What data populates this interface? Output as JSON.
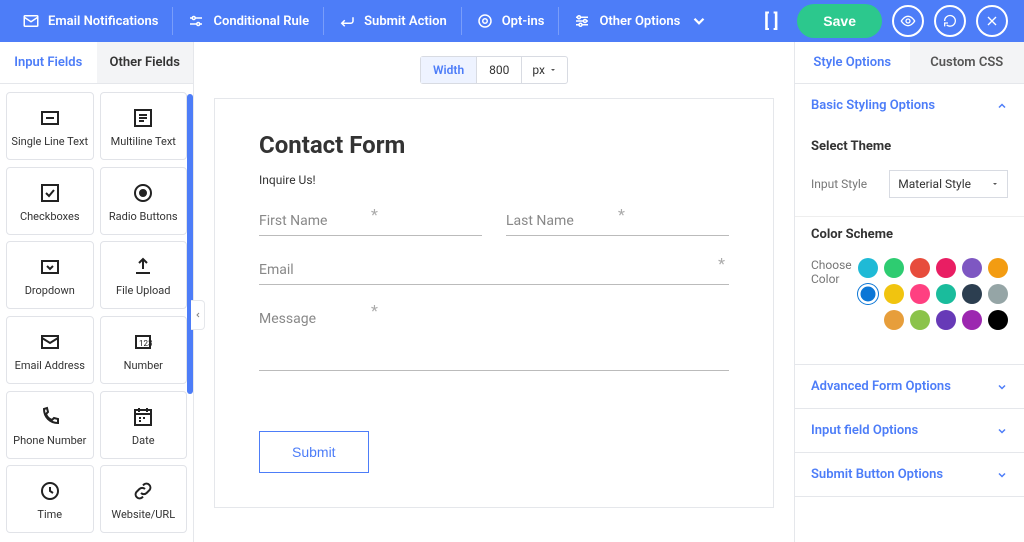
{
  "topbar": {
    "items": [
      {
        "label": "Email Notifications"
      },
      {
        "label": "Conditional Rule"
      },
      {
        "label": "Submit Action"
      },
      {
        "label": "Opt-ins"
      },
      {
        "label": "Other Options"
      }
    ],
    "save": "Save"
  },
  "left": {
    "tabs": {
      "input": "Input Fields",
      "other": "Other Fields"
    },
    "fields": {
      "single_line": "Single Line Text",
      "multiline": "Multiline Text",
      "checkboxes": "Checkboxes",
      "radio": "Radio Buttons",
      "dropdown": "Dropdown",
      "file_upload": "File Upload",
      "email": "Email Address",
      "number": "Number",
      "phone": "Phone Number",
      "date": "Date",
      "time": "Time",
      "url": "Website/URL"
    }
  },
  "canvas": {
    "width_label": "Width",
    "width_value": "800",
    "width_unit": "px",
    "form_title": "Contact Form",
    "form_sub": "Inquire Us!",
    "first_name": "First Name",
    "last_name": "Last Name",
    "email": "Email",
    "message": "Message",
    "submit": "Submit"
  },
  "right": {
    "tabs": {
      "style": "Style Options",
      "css": "Custom CSS"
    },
    "accordion": {
      "basic": "Basic Styling Options",
      "advanced": "Advanced Form Options",
      "input": "Input field Options",
      "submit": "Submit Button Options"
    },
    "select_theme": "Select Theme",
    "input_style_label": "Input Style",
    "input_style_value": "Material Style",
    "color_scheme": "Color Scheme",
    "choose_color": "Choose Color",
    "colors_row1": [
      "#1fbad6",
      "#2ecc71",
      "#e74c3c",
      "#e91e63",
      "#7e57c2",
      "#f39c12"
    ],
    "colors_row2": [
      "#0b76d6",
      "#f1c40f",
      "#ff4081",
      "#1abc9c",
      "#2c3e50",
      "#95a5a6"
    ],
    "colors_row3": [
      "#e79e3b",
      "#8bc34a",
      "#673ab7",
      "#9c27b0",
      "#000000"
    ],
    "color_selected_index": 6
  }
}
